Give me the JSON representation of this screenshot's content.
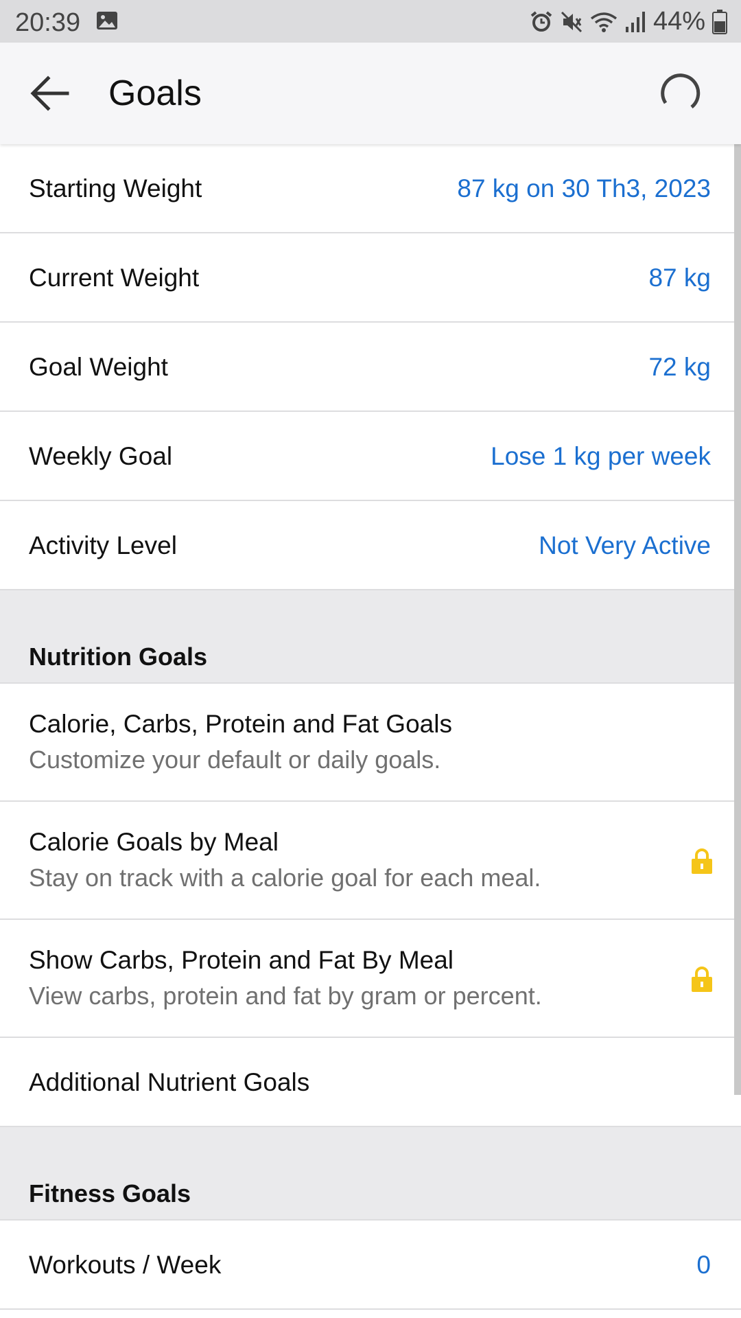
{
  "status_bar": {
    "time": "20:39",
    "battery": "44%",
    "icons": [
      "gallery-icon",
      "alarm-icon",
      "mute-icon",
      "wifi-icon",
      "signal-icon",
      "battery-icon"
    ]
  },
  "header": {
    "title": "Goals",
    "icons": [
      "back-arrow-icon",
      "loading-spinner-icon"
    ]
  },
  "weight_rows": [
    {
      "label": "Starting Weight",
      "value": "87 kg on 30 Th3, 2023"
    },
    {
      "label": "Current Weight",
      "value": "87 kg"
    },
    {
      "label": "Goal Weight",
      "value": "72 kg"
    },
    {
      "label": "Weekly Goal",
      "value": "Lose 1 kg per week"
    },
    {
      "label": "Activity Level",
      "value": "Not Very Active"
    }
  ],
  "nutrition": {
    "section_title": "Nutrition Goals",
    "items": [
      {
        "title": "Calorie, Carbs, Protein and Fat Goals",
        "subtitle": "Customize your default or daily goals."
      },
      {
        "title": "Calorie Goals by Meal",
        "subtitle": "Stay on track with a calorie goal for each meal.",
        "locked": true
      },
      {
        "title": "Show Carbs, Protein and Fat By Meal",
        "subtitle": "View carbs, protein and fat by gram or percent.",
        "locked": true
      }
    ],
    "additional": "Additional Nutrient Goals"
  },
  "fitness": {
    "section_title": "Fitness Goals",
    "workouts_label": "Workouts / Week",
    "workouts_value": "0"
  },
  "colors": {
    "accent": "#1b6fd0",
    "lock": "#f5c518",
    "section_bg": "#eaeaec",
    "subtitle": "#707070"
  }
}
